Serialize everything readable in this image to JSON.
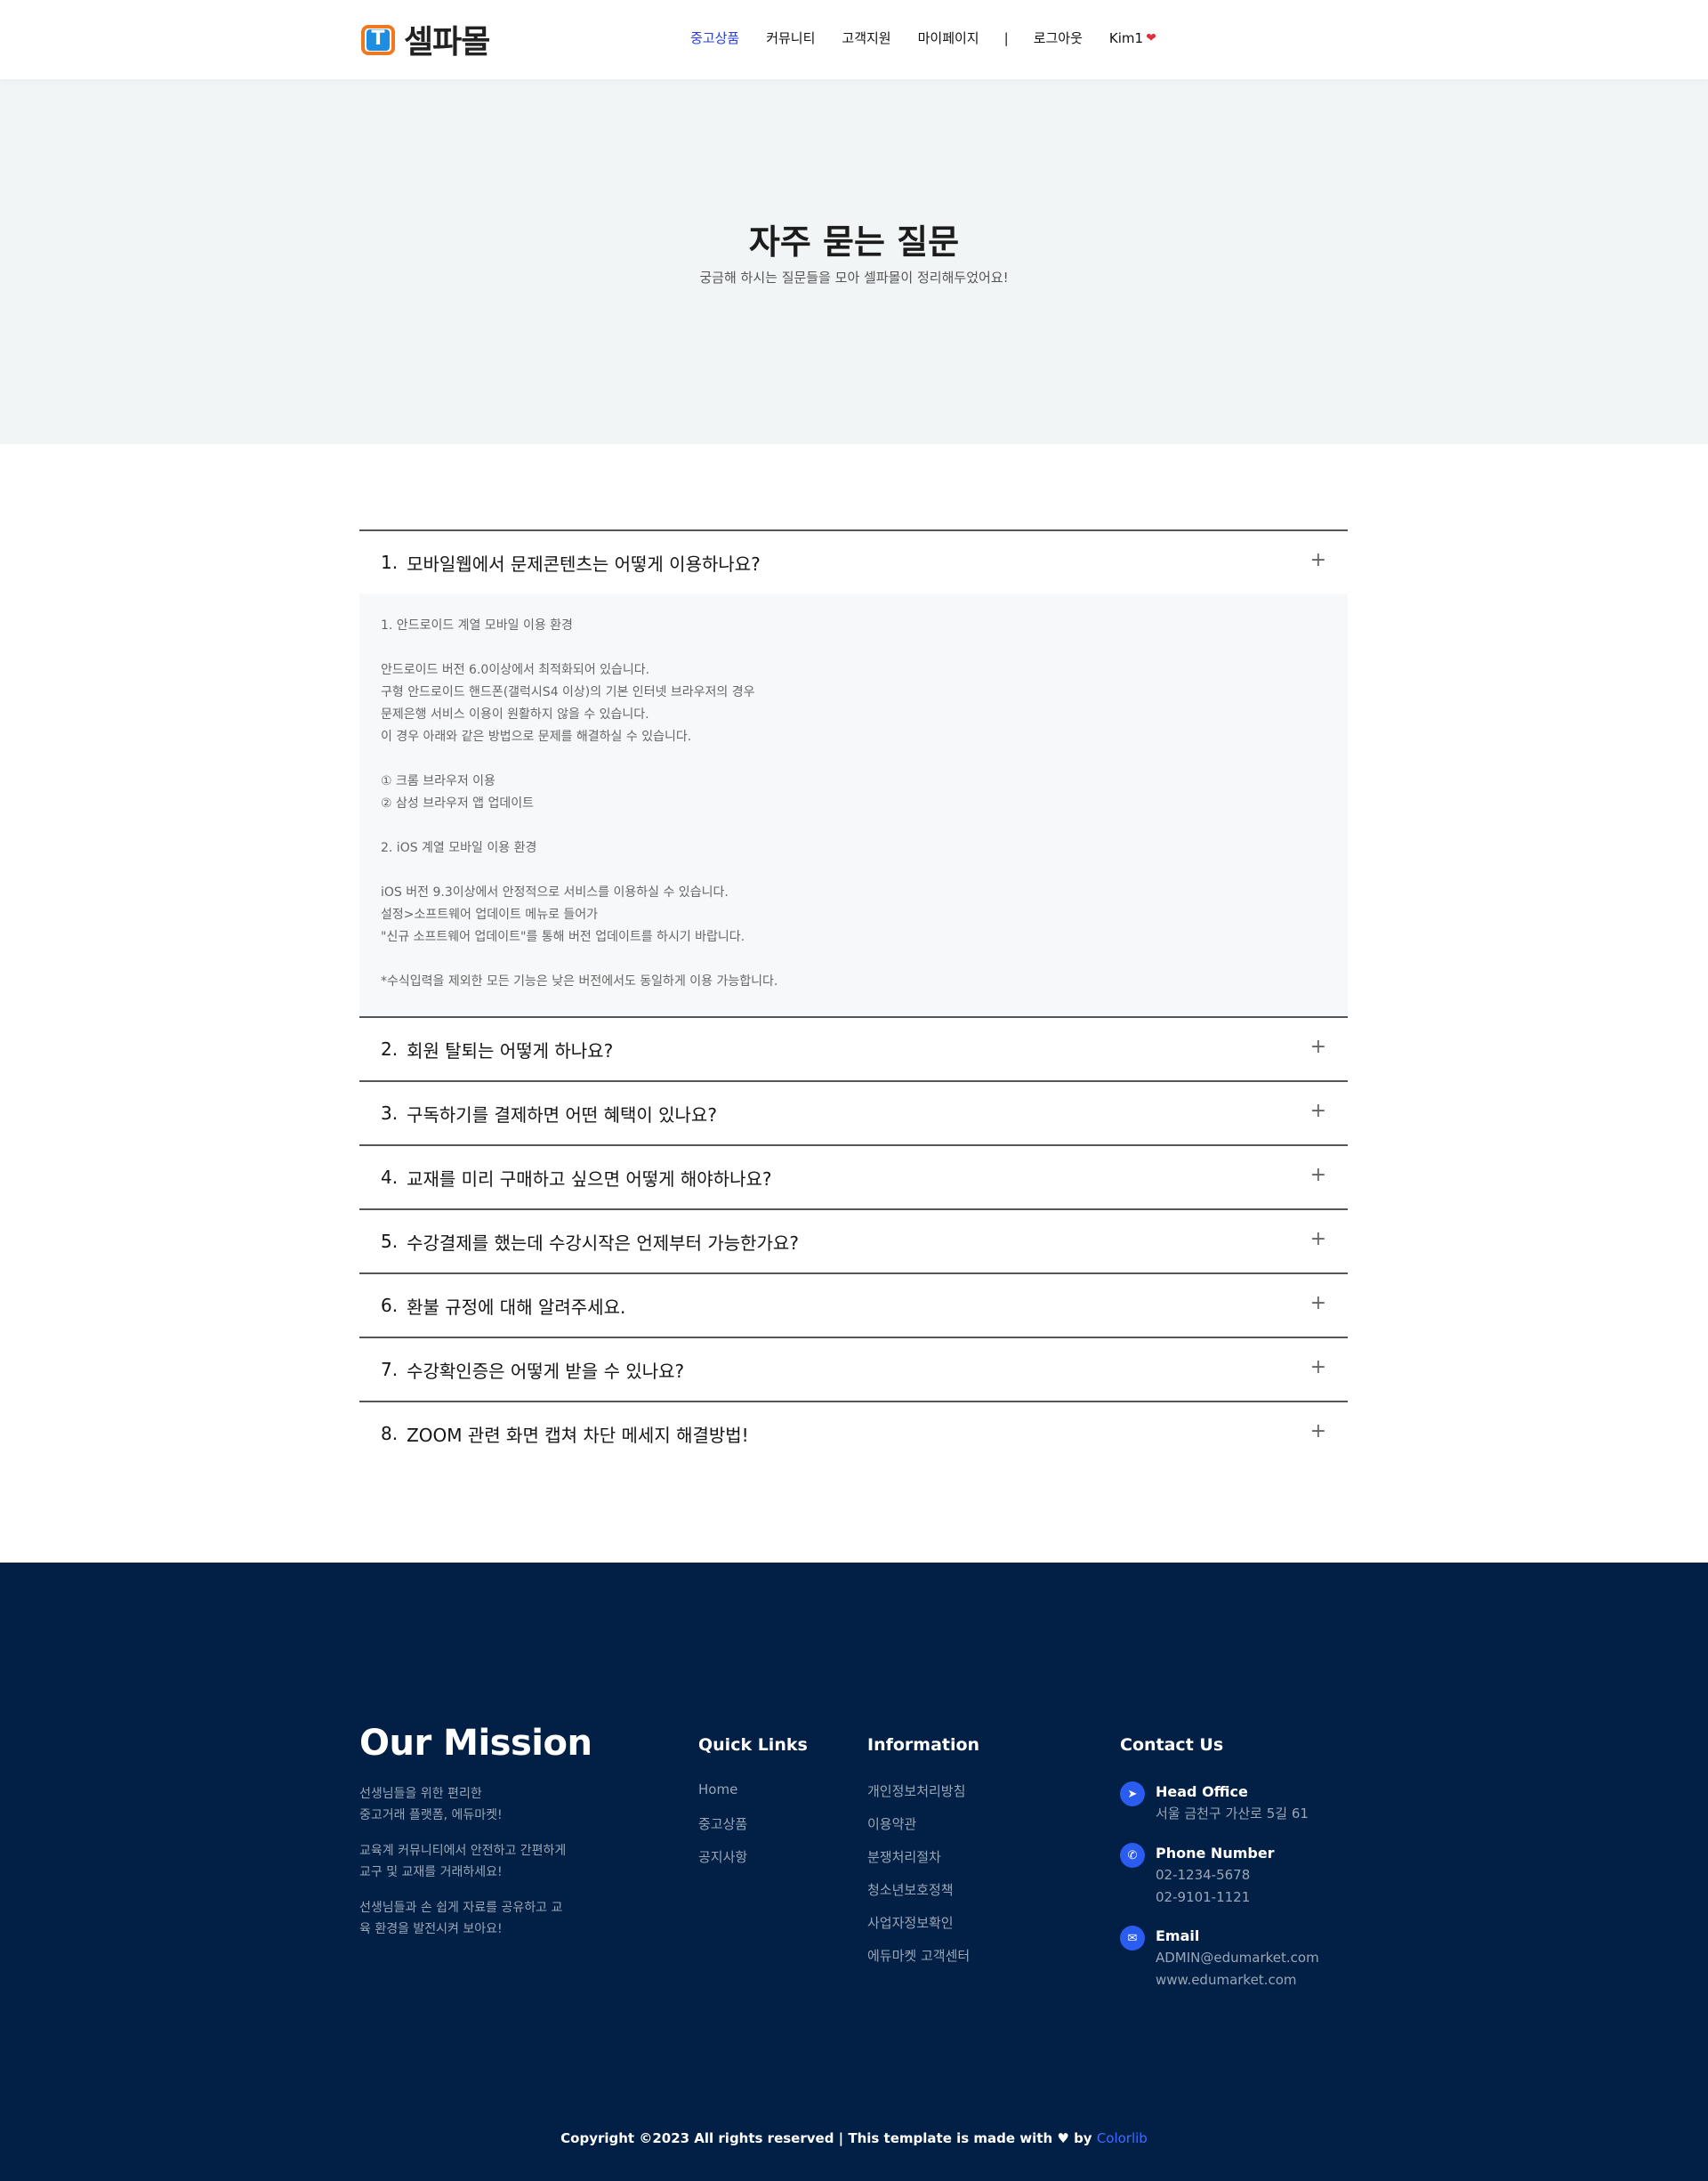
{
  "header": {
    "logo_glyph": "T",
    "logo_text": "셀파몰",
    "nav": [
      "중고상품",
      "커뮤니티",
      "고객지원",
      "마이페이지"
    ],
    "separator": "|",
    "logout": "로그아웃",
    "user": "Kim1",
    "heart": "❤",
    "accent_color": "#2a3fd8"
  },
  "hero": {
    "title": "자주 묻는 질문",
    "subtitle": "궁금해 하시는 질문들을 모아 셀파몰이 정리해두었어요!"
  },
  "faq": {
    "items": [
      {
        "num": "1.",
        "question": "모바일웹에서 문제콘텐츠는 어떻게 이용하나요?",
        "expanded": true
      },
      {
        "num": "2.",
        "question": "회원 탈퇴는 어떻게 하나요?"
      },
      {
        "num": "3.",
        "question": "구독하기를 결제하면 어떤 혜택이 있나요?"
      },
      {
        "num": "4.",
        "question": "교재를 미리 구매하고 싶으면 어떻게 해야하나요?"
      },
      {
        "num": "5.",
        "question": "수강결제를 했는데 수강시작은 언제부터 가능한가요?"
      },
      {
        "num": "6.",
        "question": "환불 규정에 대해 알려주세요."
      },
      {
        "num": "7.",
        "question": "수강확인증은 어떻게 받을 수 있나요?"
      },
      {
        "num": "8.",
        "question": "ZOOM 관련 화면 캡쳐 차단 메세지 해결방법!"
      }
    ],
    "toggle_symbol": "+",
    "answer_lines": [
      "1. 안드로이드 계열 모바일 이용 환경",
      "",
      "안드로이드 버전 6.0이상에서 최적화되어 있습니다.",
      "구형 안드로이드 핸드폰(갤럭시S4 이상)의 기본 인터넷 브라우저의 경우",
      "문제은행 서비스 이용이 원활하지 않을 수 있습니다.",
      "이 경우 아래와 같은 방법으로 문제를 해결하실 수 있습니다.",
      "",
      "① 크롬 브라우저 이용",
      "② 삼성 브라우저 앱 업데이트",
      "",
      "2. iOS 계열 모바일 이용 환경",
      "",
      "iOS 버전 9.3이상에서 안정적으로 서비스를 이용하실 수 있습니다.",
      "설정>소프트웨어 업데이트 메뉴로 들어가",
      "\"신규 소프트웨어 업데이트\"를 통해 버전 업데이트를 하시기 바랍니다.",
      "",
      "*수식입력을 제외한 모든 기능은 낮은 버전에서도 동일하게 이용 가능합니다."
    ]
  },
  "footer": {
    "mission_title": "Our Mission",
    "mission_paragraphs": [
      "선생님들을 위한 편리한\n중고거래 플랫폼, 에듀마켓!",
      "교육계 커뮤니티에서 안전하고 간편하게\n교구 및 교재를 거래하세요!",
      "선생님들과 손 쉽게 자료를 공유하고 교\n육 환경을 발전시켜 보아요!"
    ],
    "quick_links_title": "Quick Links",
    "quick_links": [
      "Home",
      "중고상품",
      "공지사항"
    ],
    "information_title": "Information",
    "information_links": [
      "개인정보처리방침",
      "이용약관",
      "분쟁처리절차",
      "청소년보호정책",
      "사업자정보확인",
      "에듀마켓 고객센터"
    ],
    "contact_title": "Contact Us",
    "contact": {
      "office_label": "Head Office",
      "office_lines": [
        "서울 금천구 가산로 5길 61"
      ],
      "phone_label": "Phone Number",
      "phone_lines": [
        "02-1234-5678",
        "02-9101-1121"
      ],
      "email_label": "Email",
      "email_lines": [
        "ADMIN@edumarket.com",
        "www.edumarket.com"
      ]
    },
    "copyright_text": "Copyright ©2023 All rights reserved | This template is made with",
    "copyright_by": "by",
    "copyright_link": "Colorlib",
    "bg_color": "#022045",
    "link_color": "#3d6cff"
  }
}
